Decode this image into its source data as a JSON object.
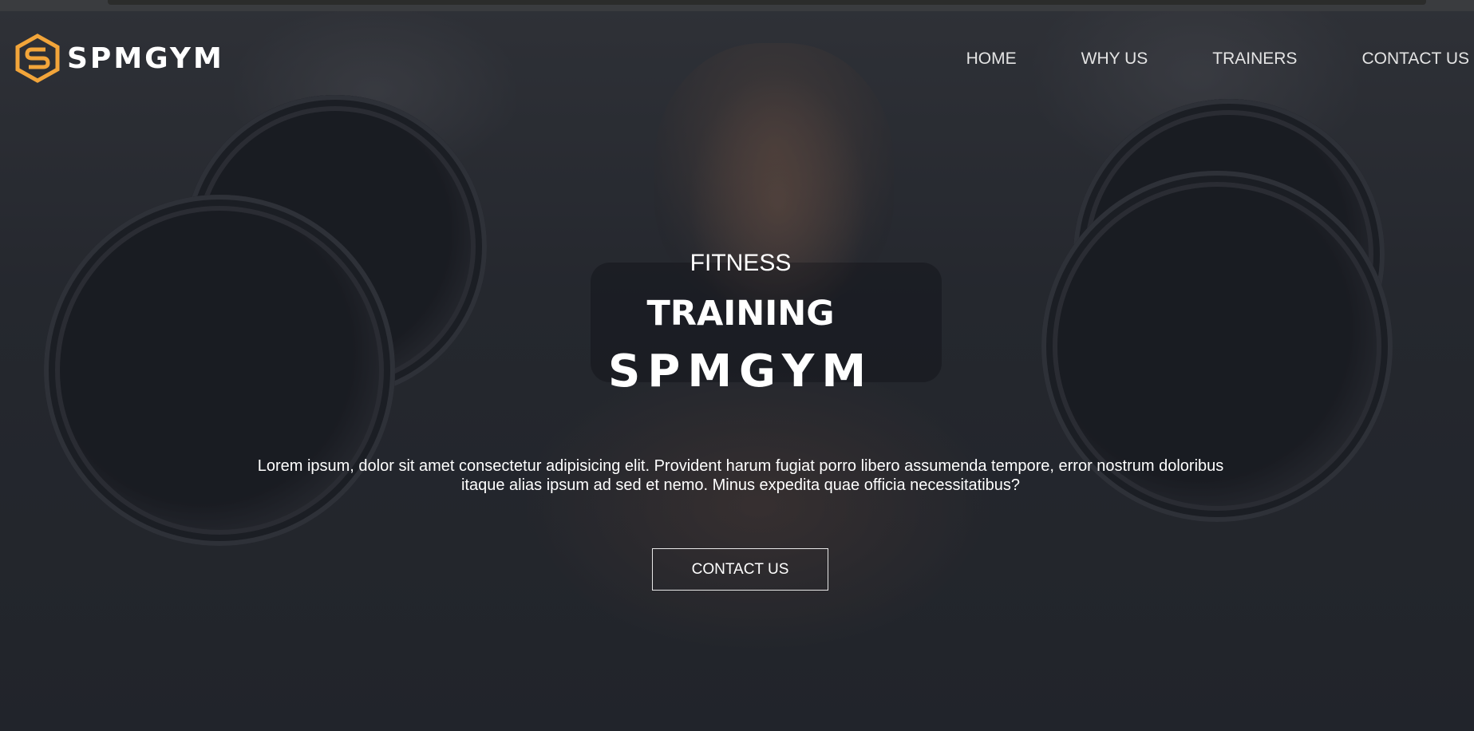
{
  "brand": {
    "name": "SPMGYM",
    "logo_icon": "hexagon-s-logo-icon",
    "logo_color": "#f2a53a"
  },
  "nav": {
    "items": [
      {
        "label": "HOME"
      },
      {
        "label": "WHY US"
      },
      {
        "label": "TRAINERS"
      },
      {
        "label": "CONTACT US"
      }
    ]
  },
  "hero": {
    "subtitle_1": "FITNESS",
    "subtitle_2": "TRAINING",
    "title": "SPMGYM",
    "description": "Lorem ipsum, dolor sit amet consectetur adipisicing elit. Provident harum fugiat porro libero assumenda tempore, error nostrum doloribus itaque alias ipsum ad sed et nemo. Minus expedita quae officia necessitatibus?",
    "cta_label": "CONTACT US"
  },
  "colors": {
    "accent": "#f2a53a",
    "text": "#ffffff",
    "overlay": "#262930"
  }
}
